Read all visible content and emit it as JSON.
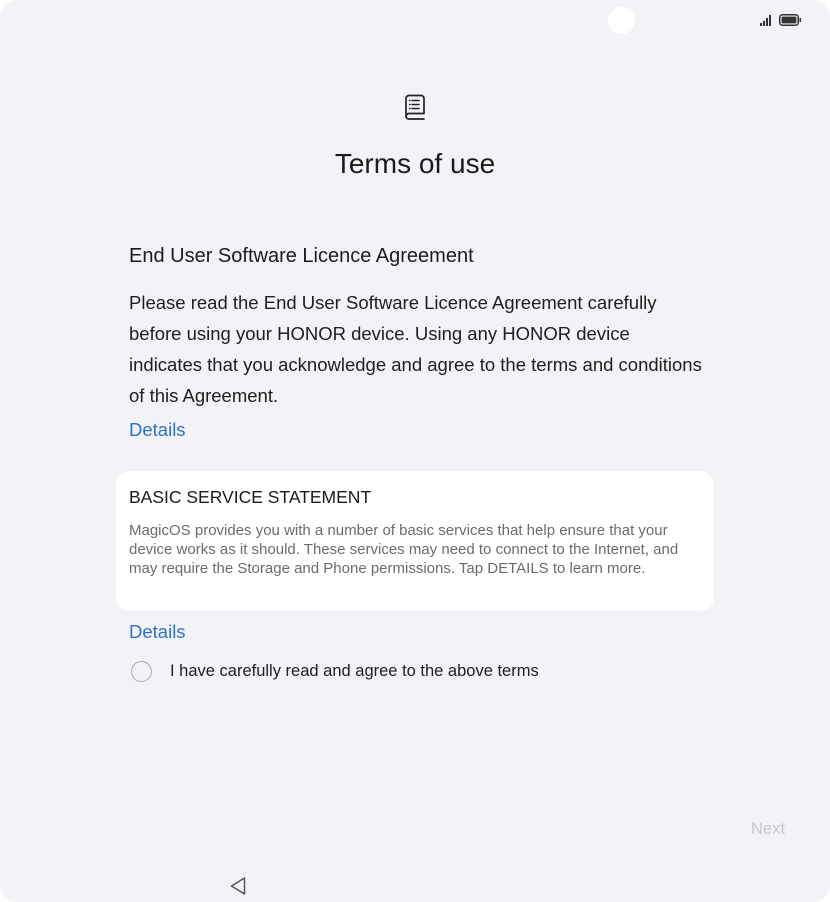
{
  "status_bar": {
    "signal_icon": "signal-bars-icon",
    "battery_icon": "battery-full-icon"
  },
  "header": {
    "icon": "document-list-icon",
    "title": "Terms of use"
  },
  "eula": {
    "title": "End User Software Licence Agreement",
    "body": "Please read the End User Software Licence Agreement carefully before using your HONOR device. Using any HONOR device indicates that you acknowledge and agree to the terms and conditions of this Agreement.",
    "details_label": "Details"
  },
  "basic_service": {
    "title": "BASIC SERVICE STATEMENT",
    "body": "MagicOS provides you with a number of basic services that help ensure that your device works as it should. These services may need to connect to the Internet, and may require the Storage and Phone permissions. Tap DETAILS to learn more.",
    "details_label": "Details"
  },
  "agreement": {
    "label": "I have carefully read and agree to the above terms",
    "checked": false
  },
  "footer": {
    "next_label": "Next",
    "next_enabled": false,
    "back_icon": "back-triangle-icon"
  },
  "colors": {
    "background": "#f2f3f7",
    "link": "#2f72c9",
    "disabled_text": "#c4c6cb"
  }
}
